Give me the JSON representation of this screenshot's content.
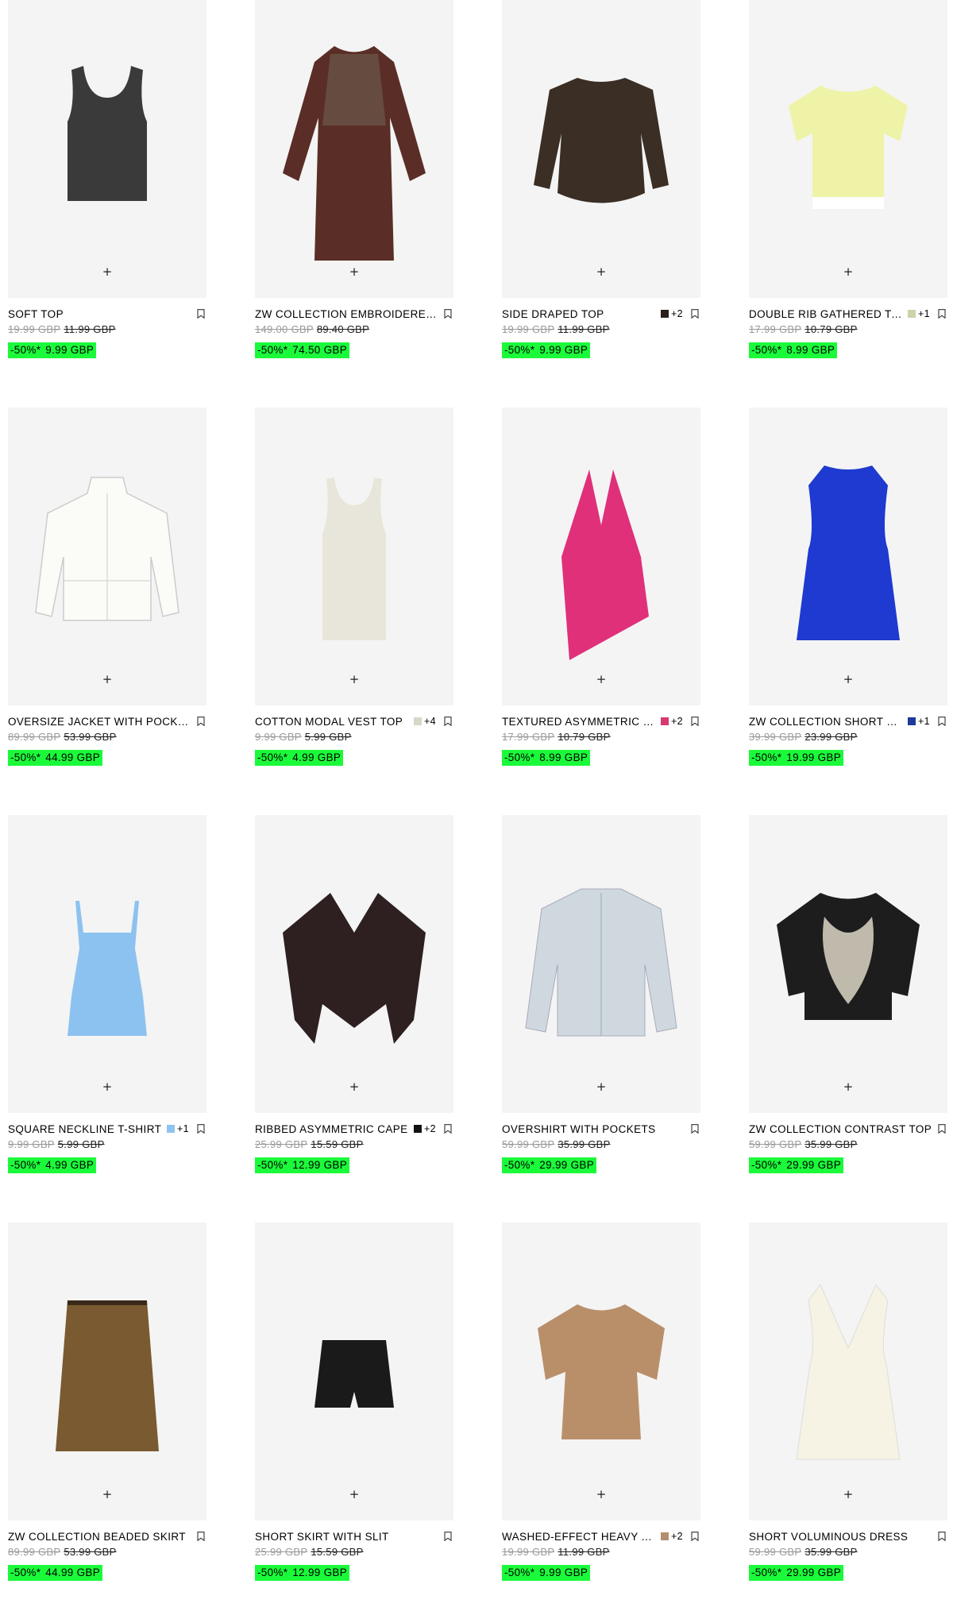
{
  "add_symbol": "+",
  "products": [
    {
      "name": "SOFT TOP",
      "old_price": "19.99 GBP",
      "prev_price": "11.99 GBP",
      "discount": "-50%*",
      "price": "9.99 GBP",
      "swatch": null,
      "more_colors": "",
      "icon": "tank-top-icon",
      "fill": "#3a3a3a"
    },
    {
      "name": "ZW COLLECTION EMBROIDERED DRESS",
      "old_price": "149.00 GBP",
      "prev_price": "89.40 GBP",
      "discount": "-50%*",
      "price": "74.50 GBP",
      "swatch": null,
      "more_colors": "",
      "icon": "long-dress-icon",
      "fill": "#5a2e26"
    },
    {
      "name": "SIDE DRAPED TOP",
      "old_price": "19.99 GBP",
      "prev_price": "11.99 GBP",
      "discount": "-50%*",
      "price": "9.99 GBP",
      "swatch": "#2a1f1a",
      "more_colors": "+2",
      "icon": "long-sleeve-top-icon",
      "fill": "#3a2e25"
    },
    {
      "name": "DOUBLE RIB GATHERED T-SHIRT",
      "old_price": "17.99 GBP",
      "prev_price": "10.79 GBP",
      "discount": "-50%*",
      "price": "8.99 GBP",
      "swatch": "#c9d4a9",
      "more_colors": "+1",
      "icon": "tshirt-icon",
      "fill": "#eef3a8"
    },
    {
      "name": "OVERSIZE JACKET WITH POCKETS",
      "old_price": "89.99 GBP",
      "prev_price": "53.99 GBP",
      "discount": "-50%*",
      "price": "44.99 GBP",
      "swatch": null,
      "more_colors": "",
      "icon": "jacket-icon",
      "fill": "#fbfbf8"
    },
    {
      "name": "COTTON MODAL VEST TOP",
      "old_price": "9.99 GBP",
      "prev_price": "5.99 GBP",
      "discount": "-50%*",
      "price": "4.99 GBP",
      "swatch": "#d8d8c8",
      "more_colors": "+4",
      "icon": "vest-icon",
      "fill": "#e8e6da"
    },
    {
      "name": "TEXTURED ASYMMETRIC HALTER TOP",
      "old_price": "17.99 GBP",
      "prev_price": "10.79 GBP",
      "discount": "-50%*",
      "price": "8.99 GBP",
      "swatch": "#d63a72",
      "more_colors": "+2",
      "icon": "halter-top-icon",
      "fill": "#e0307a"
    },
    {
      "name": "ZW COLLECTION SHORT DRESS",
      "old_price": "39.99 GBP",
      "prev_price": "23.99 GBP",
      "discount": "-50%*",
      "price": "19.99 GBP",
      "swatch": "#1f3a9a",
      "more_colors": "+1",
      "icon": "short-dress-icon",
      "fill": "#1e3ad0"
    },
    {
      "name": "SQUARE NECKLINE T-SHIRT",
      "old_price": "9.99 GBP",
      "prev_price": "5.99 GBP",
      "discount": "-50%*",
      "price": "4.99 GBP",
      "swatch": "#8ec4ef",
      "more_colors": "+1",
      "icon": "cami-top-icon",
      "fill": "#8cc2f0"
    },
    {
      "name": "RIBBED ASYMMETRIC CAPE",
      "old_price": "25.99 GBP",
      "prev_price": "15.59 GBP",
      "discount": "-50%*",
      "price": "12.99 GBP",
      "swatch": "#111111",
      "more_colors": "+2",
      "icon": "cape-icon",
      "fill": "#2e2020"
    },
    {
      "name": "OVERSHIRT WITH POCKETS",
      "old_price": "59.99 GBP",
      "prev_price": "35.99 GBP",
      "discount": "-50%*",
      "price": "29.99 GBP",
      "swatch": null,
      "more_colors": "",
      "icon": "overshirt-icon",
      "fill": "#cfd8de"
    },
    {
      "name": "ZW COLLECTION CONTRAST TOP",
      "old_price": "59.99 GBP",
      "prev_price": "35.99 GBP",
      "discount": "-50%*",
      "price": "29.99 GBP",
      "swatch": null,
      "more_colors": "",
      "icon": "embroidered-top-icon",
      "fill": "#1d1d1d"
    },
    {
      "name": "ZW COLLECTION BEADED SKIRT",
      "old_price": "89.99 GBP",
      "prev_price": "53.99 GBP",
      "discount": "-50%*",
      "price": "44.99 GBP",
      "swatch": null,
      "more_colors": "",
      "icon": "beaded-skirt-icon",
      "fill": "#7a5a30"
    },
    {
      "name": "SHORT SKIRT WITH SLIT",
      "old_price": "25.99 GBP",
      "prev_price": "15.59 GBP",
      "discount": "-50%*",
      "price": "12.99 GBP",
      "swatch": null,
      "more_colors": "",
      "icon": "mini-skirt-icon",
      "fill": "#1a1a1a"
    },
    {
      "name": "WASHED-EFFECT HEAVY T-SHIRT",
      "old_price": "19.99 GBP",
      "prev_price": "11.99 GBP",
      "discount": "-50%*",
      "price": "9.99 GBP",
      "swatch": "#b58e6e",
      "more_colors": "+2",
      "icon": "heavy-tshirt-icon",
      "fill": "#b98f6a"
    },
    {
      "name": "SHORT VOLUMINOUS DRESS",
      "old_price": "59.99 GBP",
      "prev_price": "35.99 GBP",
      "discount": "-50%*",
      "price": "29.99 GBP",
      "swatch": null,
      "more_colors": "",
      "icon": "v-neck-dress-icon",
      "fill": "#f6f2e4"
    }
  ]
}
